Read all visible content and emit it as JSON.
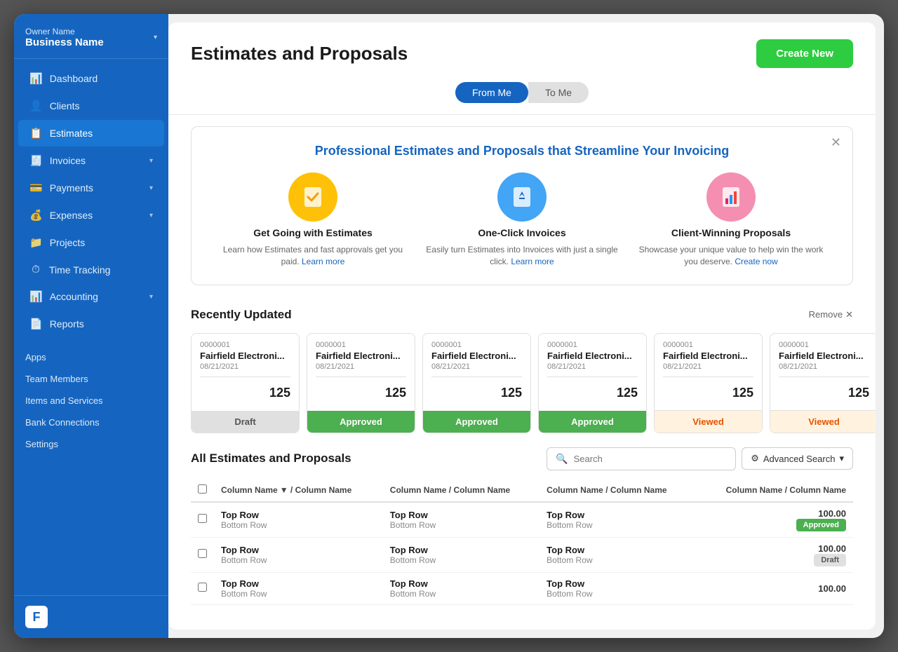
{
  "app": {
    "sidebar": {
      "owner_name": "Owner Name",
      "business_name": "Business Name",
      "nav_items": [
        {
          "id": "dashboard",
          "label": "Dashboard",
          "icon": "📊",
          "has_chevron": false
        },
        {
          "id": "clients",
          "label": "Clients",
          "icon": "👤",
          "has_chevron": false
        },
        {
          "id": "estimates",
          "label": "Estimates",
          "icon": "📋",
          "has_chevron": false,
          "active": true
        },
        {
          "id": "invoices",
          "label": "Invoices",
          "icon": "🧾",
          "has_chevron": true
        },
        {
          "id": "payments",
          "label": "Payments",
          "icon": "💳",
          "has_chevron": true
        },
        {
          "id": "expenses",
          "label": "Expenses",
          "icon": "💰",
          "has_chevron": true
        },
        {
          "id": "projects",
          "label": "Projects",
          "icon": "📁",
          "has_chevron": false
        },
        {
          "id": "time-tracking",
          "label": "Time Tracking",
          "icon": "⏱",
          "has_chevron": false
        },
        {
          "id": "accounting",
          "label": "Accounting",
          "icon": "📊",
          "has_chevron": true
        },
        {
          "id": "reports",
          "label": "Reports",
          "icon": "📄",
          "has_chevron": false
        }
      ],
      "misc_items": [
        {
          "id": "apps",
          "label": "Apps"
        },
        {
          "id": "team-members",
          "label": "Team Members"
        },
        {
          "id": "items-services",
          "label": "Items and Services"
        },
        {
          "id": "bank-connections",
          "label": "Bank Connections"
        },
        {
          "id": "settings",
          "label": "Settings"
        }
      ],
      "logo_letter": "F"
    }
  },
  "page": {
    "title": "Estimates and Proposals",
    "create_new_label": "Create New",
    "tabs": [
      {
        "id": "from-me",
        "label": "From Me",
        "active": true
      },
      {
        "id": "to-me",
        "label": "To Me",
        "active": false
      }
    ],
    "promo_banner": {
      "title": "Professional Estimates and Proposals that Streamline Your Invoicing",
      "features": [
        {
          "id": "get-going",
          "icon": "✔",
          "icon_bg": "yellow",
          "title": "Get Going with Estimates",
          "desc": "Learn how Estimates and fast approvals get you paid.",
          "link_text": "Learn more",
          "link_href": "#"
        },
        {
          "id": "one-click",
          "icon": "🔄",
          "icon_bg": "blue",
          "title": "One-Click Invoices",
          "desc": "Easily turn Estimates into Invoices with just a single click.",
          "link_text": "Learn more",
          "link_href": "#"
        },
        {
          "id": "client-winning",
          "icon": "📊",
          "icon_bg": "pink",
          "title": "Client-Winning Proposals",
          "desc": "Showcase your unique value to help win the work you deserve.",
          "link_text": "Create now",
          "link_href": "#"
        }
      ]
    },
    "recently_updated": {
      "section_title": "Recently Updated",
      "remove_label": "Remove",
      "cards": [
        {
          "number": "0000001",
          "client": "Fairfield Electroni...",
          "date": "08/21/2021",
          "amount": "125",
          "status": "Draft",
          "status_class": "draft"
        },
        {
          "number": "0000001",
          "client": "Fairfield Electroni...",
          "date": "08/21/2021",
          "amount": "125",
          "status": "Approved",
          "status_class": "approved"
        },
        {
          "number": "0000001",
          "client": "Fairfield Electroni...",
          "date": "08/21/2021",
          "amount": "125",
          "status": "Approved",
          "status_class": "approved"
        },
        {
          "number": "0000001",
          "client": "Fairfield Electroni...",
          "date": "08/21/2021",
          "amount": "125",
          "status": "Approved",
          "status_class": "approved"
        },
        {
          "number": "0000001",
          "client": "Fairfield Electroni...",
          "date": "08/21/2021",
          "amount": "125",
          "status": "Viewed",
          "status_class": "viewed"
        },
        {
          "number": "0000001",
          "client": "Fairfield Electroni...",
          "date": "08/21/2021",
          "amount": "125",
          "status": "Viewed",
          "status_class": "viewed"
        }
      ]
    },
    "all_estimates": {
      "section_title": "All Estimates and Proposals",
      "search_placeholder": "Search",
      "advanced_search_label": "Advanced Search",
      "table_columns": [
        {
          "id": "col1",
          "label": "Column Name",
          "sub": "Column Name",
          "sortable": true
        },
        {
          "id": "col2",
          "label": "Column Name",
          "sub": "Column Name"
        },
        {
          "id": "col3",
          "label": "Column Name",
          "sub": "Column Name"
        },
        {
          "id": "col4",
          "label": "Column Name",
          "sub": "Column Name",
          "align": "right"
        }
      ],
      "rows": [
        {
          "id": "row1",
          "col1_top": "Top Row",
          "col1_bottom": "Bottom Row",
          "col2_top": "Top Row",
          "col2_bottom": "Bottom Row",
          "col3_top": "Top Row",
          "col3_bottom": "Bottom Row",
          "amount": "100.00",
          "status": "Approved",
          "status_class": "approved"
        },
        {
          "id": "row2",
          "col1_top": "Top Row",
          "col1_bottom": "Bottom Row",
          "col2_top": "Top Row",
          "col2_bottom": "Bottom Row",
          "col3_top": "Top Row",
          "col3_bottom": "Bottom Row",
          "amount": "100.00",
          "status": "Draft",
          "status_class": "draft"
        },
        {
          "id": "row3",
          "col1_top": "Top Row",
          "col1_bottom": "Bottom Row",
          "col2_top": "Top Row",
          "col2_bottom": "Bottom Row",
          "col3_top": "Top Row",
          "col3_bottom": "Bottom Row",
          "amount": "100.00",
          "status": "",
          "status_class": ""
        }
      ]
    }
  }
}
